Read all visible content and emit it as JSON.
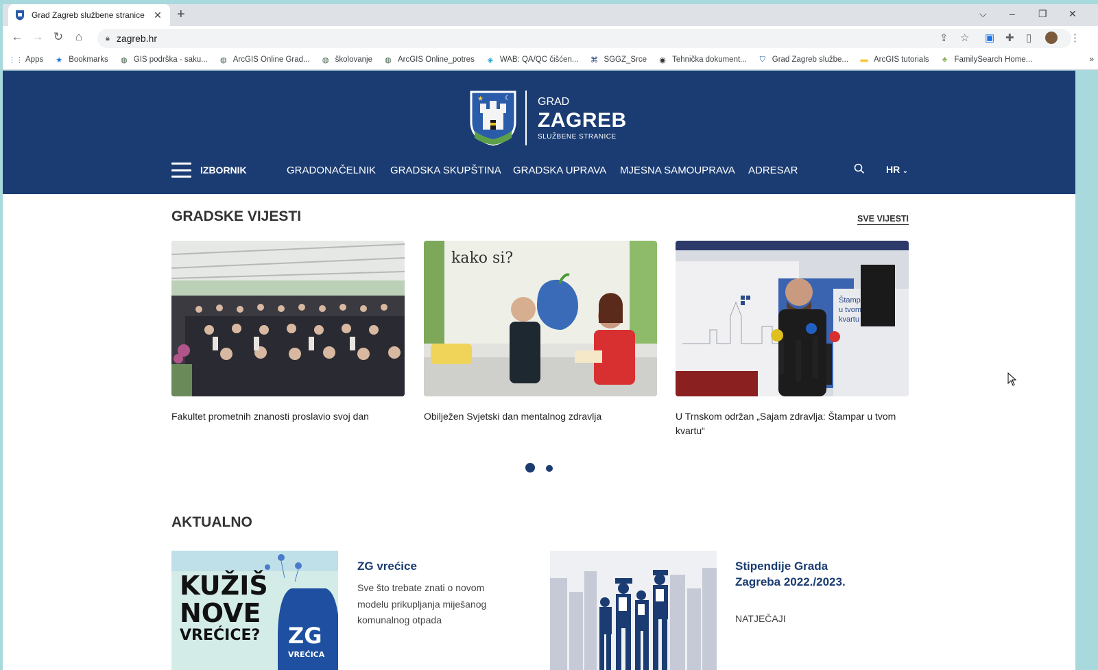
{
  "browser": {
    "tab_title": "Grad Zagreb službene stranice",
    "url": "zagreb.hr",
    "bookmarks": [
      {
        "label": "Apps",
        "icon": "apps-grid-icon"
      },
      {
        "label": "Bookmarks",
        "icon": "star-icon"
      },
      {
        "label": "GIS podrška - saku...",
        "icon": "globe-icon"
      },
      {
        "label": "ArcGIS Online Grad...",
        "icon": "globe-icon"
      },
      {
        "label": "školovanje",
        "icon": "globe-icon"
      },
      {
        "label": "ArcGIS Online_potres",
        "icon": "globe-icon"
      },
      {
        "label": "WAB: QA/QC čišćen...",
        "icon": "wab-icon"
      },
      {
        "label": "SGGZ_Srce",
        "icon": "srce-icon"
      },
      {
        "label": "Tehnička dokument...",
        "icon": "circle-icon"
      },
      {
        "label": "Grad Zagreb službe...",
        "icon": "shield-icon"
      },
      {
        "label": "ArcGIS tutorials",
        "icon": "folder-icon"
      },
      {
        "label": "FamilySearch Home...",
        "icon": "tree-icon"
      }
    ],
    "more": "»"
  },
  "header": {
    "logo_grad": "GRAD",
    "logo_zagreb": "ZAGREB",
    "logo_sub": "SLUŽBENE STRANICE",
    "menu_label": "IZBORNIK",
    "nav": [
      "GRADONAČELNIK",
      "GRADSKA SKUPŠTINA",
      "GRADSKA UPRAVA",
      "MJESNA SAMOUPRAVA",
      "ADRESAR"
    ],
    "lang": "HR",
    "brand_color": "#1b3c72"
  },
  "news": {
    "title": "GRADSKE VIJESTI",
    "all_link": "SVE VIJESTI",
    "items": [
      {
        "title": "Fakultet prometnih znanosti proslavio svoj dan"
      },
      {
        "title": "Obilježen Svjetski dan mentalnog zdravlja",
        "image_text": "kako si?"
      },
      {
        "title": "U Trnskom održan „Sajam zdravlja: Štampar u tvom kvartu“",
        "image_text": "Štampar u tvom kvartu"
      }
    ],
    "pager": {
      "pages": 2,
      "active": 1
    }
  },
  "aktualno": {
    "title": "AKTUALNO",
    "items": [
      {
        "title": "ZG vrećice",
        "desc": "Sve što trebate znati o novom modelu prikupljanja miješanog komunalnog otpada",
        "image_text": "KUŽIŠ NOVE VREĆICE?",
        "badge": "ZG",
        "badge_sub": "VREĆICA"
      },
      {
        "title": "Stipendije Grada Zagreba 2022./2023.",
        "desc": "NATJEČAJI"
      }
    ]
  }
}
